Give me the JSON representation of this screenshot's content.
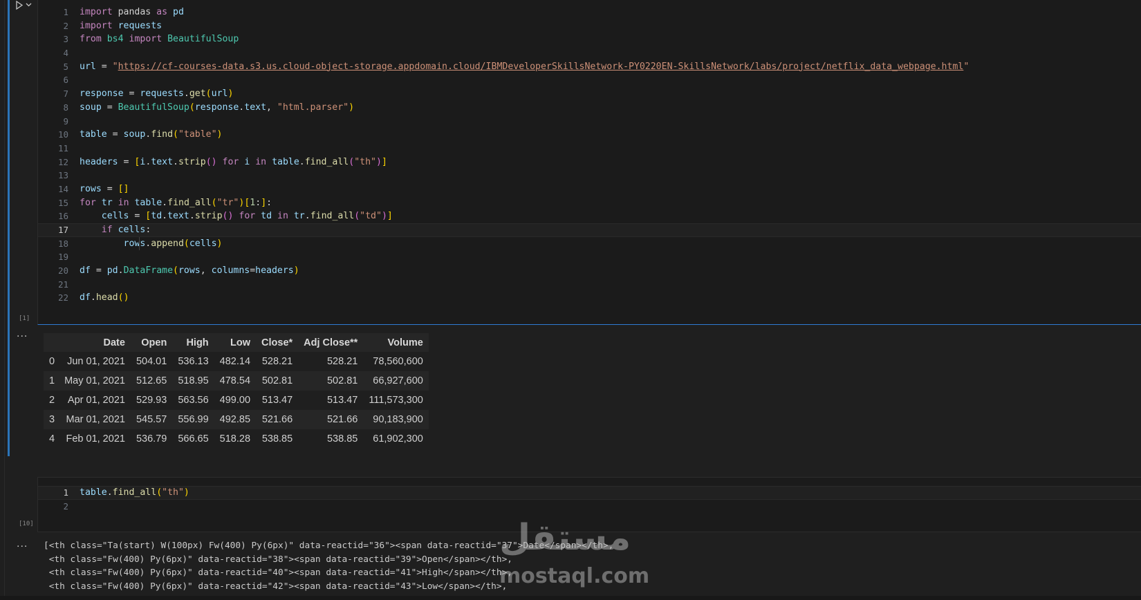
{
  "cell1": {
    "exec_count": "[1]",
    "lines": [
      {
        "n": "1",
        "t": "import pandas as pd"
      },
      {
        "n": "2",
        "t": "import requests"
      },
      {
        "n": "3",
        "t": "from bs4 import BeautifulSoup"
      },
      {
        "n": "4",
        "t": ""
      },
      {
        "n": "5",
        "t": "url = \"https://cf-courses-data.s3.us.cloud-object-storage.appdomain.cloud/IBMDeveloperSkillsNetwork-PY0220EN-SkillsNetwork/labs/project/netflix_data_webpage.html\""
      },
      {
        "n": "6",
        "t": ""
      },
      {
        "n": "7",
        "t": "response = requests.get(url)"
      },
      {
        "n": "8",
        "t": "soup = BeautifulSoup(response.text, \"html.parser\")"
      },
      {
        "n": "9",
        "t": ""
      },
      {
        "n": "10",
        "t": "table = soup.find(\"table\")"
      },
      {
        "n": "11",
        "t": ""
      },
      {
        "n": "12",
        "t": "headers = [i.text.strip() for i in table.find_all(\"th\")]"
      },
      {
        "n": "13",
        "t": ""
      },
      {
        "n": "14",
        "t": "rows = []"
      },
      {
        "n": "15",
        "t": "for tr in table.find_all(\"tr\")[1:]:"
      },
      {
        "n": "16",
        "t": "    cells = [td.text.strip() for td in tr.find_all(\"td\")]"
      },
      {
        "n": "17",
        "t": "    if cells:"
      },
      {
        "n": "18",
        "t": "        rows.append(cells)"
      },
      {
        "n": "19",
        "t": ""
      },
      {
        "n": "20",
        "t": "df = pd.DataFrame(rows, columns=headers)"
      },
      {
        "n": "21",
        "t": ""
      },
      {
        "n": "22",
        "t": "df.head()"
      }
    ]
  },
  "output1": {
    "ellipsis": "...",
    "columns": [
      "",
      "Date",
      "Open",
      "High",
      "Low",
      "Close*",
      "Adj Close**",
      "Volume"
    ],
    "rows": [
      [
        "0",
        "Jun 01, 2021",
        "504.01",
        "536.13",
        "482.14",
        "528.21",
        "528.21",
        "78,560,600"
      ],
      [
        "1",
        "May 01, 2021",
        "512.65",
        "518.95",
        "478.54",
        "502.81",
        "502.81",
        "66,927,600"
      ],
      [
        "2",
        "Apr 01, 2021",
        "529.93",
        "563.56",
        "499.00",
        "513.47",
        "513.47",
        "111,573,300"
      ],
      [
        "3",
        "Mar 01, 2021",
        "545.57",
        "556.99",
        "492.85",
        "521.66",
        "521.66",
        "90,183,900"
      ],
      [
        "4",
        "Feb 01, 2021",
        "536.79",
        "566.65",
        "518.28",
        "538.85",
        "538.85",
        "61,902,300"
      ]
    ]
  },
  "cell2": {
    "exec_count": "[10]",
    "lines": [
      {
        "n": "1",
        "t": "table.find_all(\"th\")"
      },
      {
        "n": "2",
        "t": ""
      }
    ]
  },
  "output2": {
    "ellipsis": "...",
    "lines": [
      "[<th class=\"Ta(start) W(100px) Fw(400) Py(6px)\" data-reactid=\"36\"><span data-reactid=\"37\">Date</span></th>,",
      " <th class=\"Fw(400) Py(6px)\" data-reactid=\"38\"><span data-reactid=\"39\">Open</span></th>,",
      " <th class=\"Fw(400) Py(6px)\" data-reactid=\"40\"><span data-reactid=\"41\">High</span></th>,",
      " <th class=\"Fw(400) Py(6px)\" data-reactid=\"42\"><span data-reactid=\"43\">Low</span></th>,"
    ]
  },
  "watermark": {
    "arabic": "مستقل",
    "latin": "mostaql.com"
  },
  "colors": {
    "background": "#1f1f1f",
    "focus_accent": "#2b74b8",
    "keyword": "#c586c0",
    "string": "#ce9178",
    "function": "#dcdcaa",
    "variable": "#9cdcfe",
    "class": "#4ec9b0"
  },
  "icons": {
    "run": "play-icon",
    "run_menu": "chevron-down-icon",
    "output_menu": "ellipsis-icon"
  }
}
